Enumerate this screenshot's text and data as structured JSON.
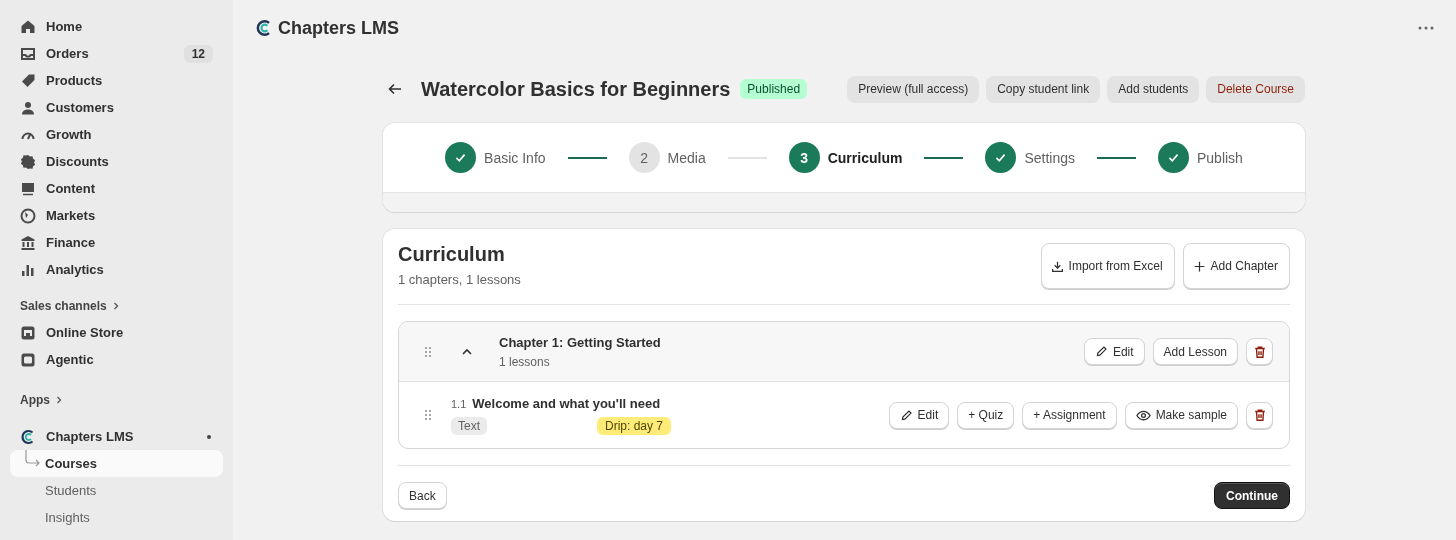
{
  "sidebar": {
    "items": [
      {
        "label": "Home"
      },
      {
        "label": "Orders",
        "badge": "12"
      },
      {
        "label": "Products"
      },
      {
        "label": "Customers"
      },
      {
        "label": "Growth"
      },
      {
        "label": "Discounts"
      },
      {
        "label": "Content"
      },
      {
        "label": "Markets"
      },
      {
        "label": "Finance"
      },
      {
        "label": "Analytics"
      }
    ],
    "sales_channels": {
      "title": "Sales channels",
      "items": [
        {
          "label": "Online Store"
        },
        {
          "label": "Agentic"
        }
      ]
    },
    "apps": {
      "title": "Apps",
      "app": {
        "label": "Chapters LMS",
        "expanded": true,
        "children": [
          {
            "label": "Courses",
            "selected": true
          },
          {
            "label": "Students",
            "selected": false
          },
          {
            "label": "Insights",
            "selected": false
          }
        ]
      }
    }
  },
  "header": {
    "brand": "Chapters LMS"
  },
  "course": {
    "title": "Watercolor Basics for Beginners",
    "status": "Published",
    "actions": [
      {
        "label": "Preview (full access)",
        "kind": "default"
      },
      {
        "label": "Copy student link",
        "kind": "default"
      },
      {
        "label": "Add students",
        "kind": "default"
      },
      {
        "label": "Delete Course",
        "kind": "danger"
      }
    ]
  },
  "steps": [
    {
      "label": "Basic Info",
      "done": true,
      "selected": false
    },
    {
      "label": "Media",
      "number": "2",
      "done": false,
      "selected": false
    },
    {
      "label": "Curriculum",
      "number": "3",
      "done": false,
      "selected": true
    },
    {
      "label": "Settings",
      "done": true,
      "selected": false
    },
    {
      "label": "Publish",
      "done": true,
      "selected": false
    }
  ],
  "curriculum": {
    "title": "Curriculum",
    "summary": "1 chapters, 1 lessons",
    "buttons": [
      {
        "label": "Import from Excel",
        "kind": "import"
      },
      {
        "label": "Add Chapter",
        "kind": "add"
      }
    ],
    "chapters": [
      {
        "title": "Chapter 1: Getting Started",
        "meta": "1 lessons",
        "expanded": true,
        "edit_label": "Edit",
        "add_lesson_label": "Add Lesson",
        "lessons": [
          {
            "number": "1.1",
            "title": "Welcome and what you'll need",
            "type": "Text",
            "drip": "Drip: day 7",
            "actions": [
              {
                "label": "Edit",
                "kind": "edit"
              },
              {
                "label": "+ Quiz",
                "kind": "plain"
              },
              {
                "label": "+ Assignment",
                "kind": "plain"
              },
              {
                "label": "Make sample",
                "kind": "sample"
              }
            ]
          }
        ]
      }
    ]
  },
  "footer": {
    "back": "Back",
    "continue": "Continue"
  }
}
